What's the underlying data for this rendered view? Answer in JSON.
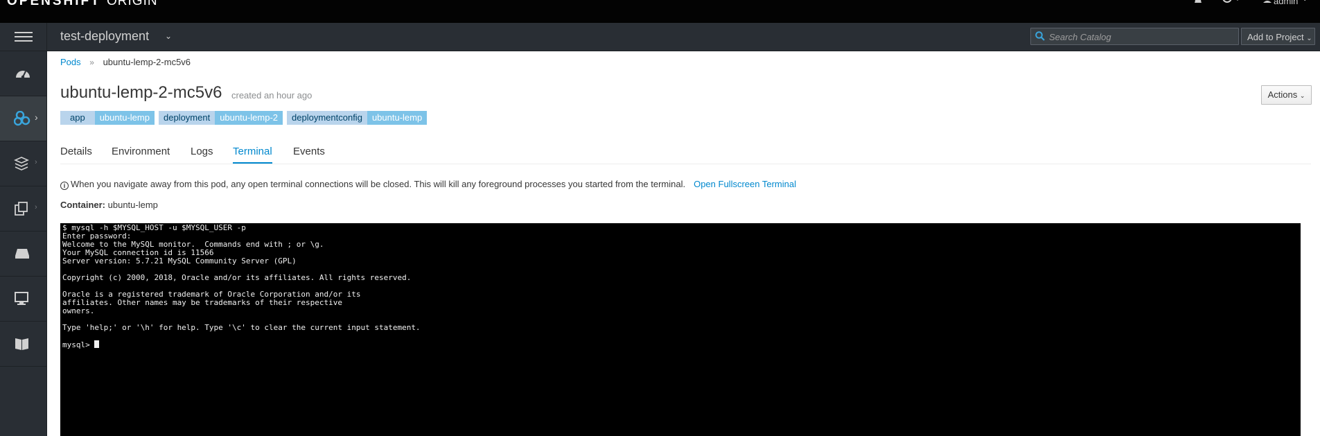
{
  "masthead": {
    "brand_bold": "OPENSHIFT",
    "brand_thin": "ORIGIN",
    "user_label": "admin"
  },
  "project_bar": {
    "project_name": "test-deployment",
    "search_placeholder": "Search Catalog",
    "add_to_project": "Add to Project"
  },
  "sidebar": {
    "items": [
      {
        "icon": "dashboard-icon"
      },
      {
        "icon": "applications-icon"
      },
      {
        "icon": "builds-icon"
      },
      {
        "icon": "resources-icon"
      },
      {
        "icon": "storage-icon"
      },
      {
        "icon": "monitoring-icon"
      },
      {
        "icon": "catalog-icon"
      }
    ]
  },
  "breadcrumb": {
    "parent": "Pods",
    "current": "ubuntu-lemp-2-mc5v6"
  },
  "page": {
    "title": "ubuntu-lemp-2-mc5v6",
    "subtitle": "created an hour ago",
    "actions_label": "Actions",
    "labels": [
      {
        "key": "app",
        "value": "ubuntu-lemp"
      },
      {
        "key": "deployment",
        "value": "ubuntu-lemp-2"
      },
      {
        "key": "deploymentconfig",
        "value": "ubuntu-lemp"
      }
    ],
    "tabs": [
      "Details",
      "Environment",
      "Logs",
      "Terminal",
      "Events"
    ],
    "active_tab": "Terminal",
    "info_text": "When you navigate away from this pod, any open terminal connections will be closed. This will kill any foreground processes you started from the terminal.",
    "fullscreen_link": "Open Fullscreen Terminal",
    "container_label": "Container:",
    "container_name": "ubuntu-lemp"
  },
  "terminal": {
    "output": "$ mysql -h $MYSQL_HOST -u $MYSQL_USER -p\nEnter password:\nWelcome to the MySQL monitor.  Commands end with ; or \\g.\nYour MySQL connection id is 11566\nServer version: 5.7.21 MySQL Community Server (GPL)\n\nCopyright (c) 2000, 2018, Oracle and/or its affiliates. All rights reserved.\n\nOracle is a registered trademark of Oracle Corporation and/or its\naffiliates. Other names may be trademarks of their respective\nowners.\n\nType 'help;' or '\\h' for help. Type '\\c' to clear the current input statement.\n\n",
    "prompt": "mysql> "
  },
  "colors": {
    "masthead_bg": "#030303",
    "nav_bg": "#292e34",
    "link": "#0088ce",
    "label_key_bg": "#b9d4ec",
    "label_value_bg": "#7dc3e8",
    "terminal_bg": "#000000"
  }
}
